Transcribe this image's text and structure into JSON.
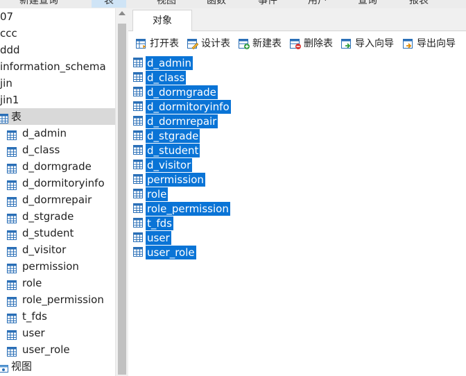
{
  "menubar": {
    "items": [
      "新建查询",
      "表",
      "视图",
      "函数",
      "事件",
      "用户",
      "查询",
      "报表"
    ]
  },
  "sidebar": {
    "databases": [
      "07",
      "ccc",
      "ddd",
      "information_schema",
      "jin",
      "jin1"
    ],
    "tables_node": "表",
    "tables": [
      "d_admin",
      "d_class",
      "d_dormgrade",
      "d_dormitoryinfo",
      "d_dormrepair",
      "d_stgrade",
      "d_student",
      "d_visitor",
      "permission",
      "role",
      "role_permission",
      "t_fds",
      "user",
      "user_role"
    ],
    "views_node": "视图"
  },
  "main": {
    "tab_label": "对象",
    "toolbar": {
      "open": "打开表",
      "design": "设计表",
      "new": "新建表",
      "delete": "删除表",
      "import": "导入向导",
      "export": "导出向导"
    },
    "objects": [
      "d_admin",
      "d_class",
      "d_dormgrade",
      "d_dormitoryinfo",
      "d_dormrepair",
      "d_stgrade",
      "d_student",
      "d_visitor",
      "permission",
      "role",
      "role_permission",
      "t_fds",
      "user",
      "user_role"
    ]
  },
  "colors": {
    "selection_bg": "#0a74d6",
    "tree_selected_bg": "#d9d9d9",
    "table_icon": "#2a6fb7"
  },
  "icons": {
    "table": "table-icon",
    "view": "view-icon",
    "open": "open-table-icon",
    "design": "design-table-icon",
    "new": "new-table-icon",
    "delete": "delete-table-icon",
    "import": "import-wizard-icon",
    "export": "export-wizard-icon"
  }
}
